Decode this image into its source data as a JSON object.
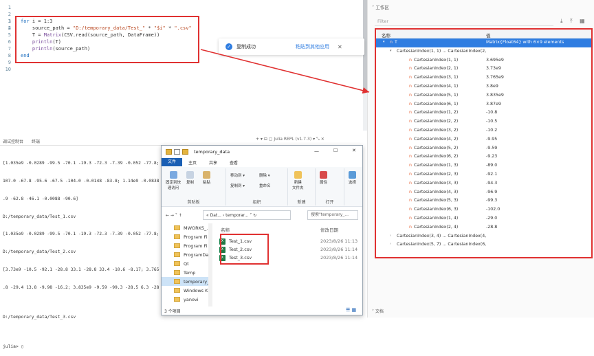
{
  "editor": {
    "line_numbers": [
      "1",
      "2",
      "3",
      "4",
      "5",
      "6",
      "7",
      "8",
      "9",
      "10"
    ],
    "code": {
      "l3_kw": "for",
      "l3_rest": " i = 1:3",
      "l4_a": "    source_path = ",
      "l4_b": "\"D:/temporary_data/Test_\"",
      "l4_c": " * ",
      "l4_d": "\"$i\"",
      "l4_e": " * ",
      "l4_f": "\".csv\"",
      "l5_a": "    T = ",
      "l5_b": "Matrix",
      "l5_c": "(CSV.read(source_path, DataFrame))",
      "l6_a": "    ",
      "l6_b": "println",
      "l6_c": "(T)",
      "l7_a": "    ",
      "l7_b": "println",
      "l7_c": "(source_path)",
      "l8": "end"
    }
  },
  "toast": {
    "message": "复制成功",
    "link": "粘贴到其他应用",
    "close": "✕",
    "check": "✓"
  },
  "repl": {
    "tab_debug": "调试控制台",
    "tab_terminal": "终端",
    "toolbar": "+ ▾ ⊟ ▢ Julia REPL (v1.7.3) ▾ ⤡ ✕",
    "lines": [
      "[1.035e9 -0.0289 -99.5 -70.1 -19.3 -72.3 -7.39 -0.052 -77.8;",
      "107.0 -67.8 -95.6 -67.5 -104.0 -0.0148 -83.8; 1.14e9 -0.0838",
      ".9 -62.8 -46.1 -0.0088 -90.6]",
      "D:/temporary_data/Test_1.csv",
      "[1.035e9 -0.0289 -99.5 -70.1 -19.3 -72.3 -7.39 -0.052 -77.8;",
      "D:/temporary_data/Test_2.csv",
      "[3.73e9 -10.5 -92.1 -28.8 33.1 -28.8 33.4 -10.6 -8.17; 3.765e",
      ".8 -29.4 13.8 -9.98 -16.2; 3.835e9 -9.59 -99.3 -28.5 6.3 -28.",
      "",
      "D:/temporary_data/Test_3.csv",
      "",
      "julia> ▯"
    ]
  },
  "explorer": {
    "title": "temporary_data",
    "win_min": "—",
    "win_max": "☐",
    "win_close": "✕",
    "ribbon_tabs": [
      "文件",
      "主页",
      "共享",
      "查看"
    ],
    "ribbon": {
      "pin": "固定到快\n速访问",
      "copy": "复制",
      "paste": "粘贴",
      "move_to": "移动到 ▾",
      "delete": "删除 ▾",
      "copy_to": "复制到 ▾",
      "rename": "重命名",
      "new_folder": "新建\n文件夹",
      "properties": "属性",
      "select": "选择",
      "g_clipboard": "剪贴板",
      "g_organize": "组织",
      "g_new": "新建",
      "g_open": "打开"
    },
    "addr_nav": "←  →  ˅  ↑",
    "addr_path": "«  Dat...  ›  temporar...  ˅  ↻",
    "search_placeholder": "搜索\"temporary_...",
    "nav_items": [
      "MWORKS_...",
      "Program Fi",
      "Program Fi",
      "ProgramDa",
      "Qt",
      "Temp",
      "temporary_",
      "Windows K",
      "yanovi"
    ],
    "col_name": "名称",
    "col_date": "修改日期",
    "files": [
      {
        "name": "Test_1.csv",
        "date": "2023/8/26 11:13"
      },
      {
        "name": "Test_2.csv",
        "date": "2023/8/26 11:14"
      },
      {
        "name": "Test_3.csv",
        "date": "2023/8/26 11:14"
      }
    ],
    "status": "3 个项目",
    "view_icons": "☰ ▦"
  },
  "workspace": {
    "title": "˅ 工作区",
    "filter_placeholder": "Filter",
    "tools": "⤓ ⤒ ▦",
    "col_name": "名称",
    "col_value": "值",
    "var_row": {
      "name": "T",
      "value": "Matrix{Float64} with 6×9 elements"
    },
    "group1": "CartesianIndex(1, 1) ... CartesianIndex(2,",
    "entries": [
      {
        "name": "CartesianIndex(1, 1)",
        "value": "3.695e9"
      },
      {
        "name": "CartesianIndex(2, 1)",
        "value": "3.73e9"
      },
      {
        "name": "CartesianIndex(3, 1)",
        "value": "3.765e9"
      },
      {
        "name": "CartesianIndex(4, 1)",
        "value": "3.8e9"
      },
      {
        "name": "CartesianIndex(5, 1)",
        "value": "3.835e9"
      },
      {
        "name": "CartesianIndex(6, 1)",
        "value": "3.87e9"
      },
      {
        "name": "CartesianIndex(1, 2)",
        "value": "-10.8"
      },
      {
        "name": "CartesianIndex(2, 2)",
        "value": "-10.5"
      },
      {
        "name": "CartesianIndex(3, 2)",
        "value": "-10.2"
      },
      {
        "name": "CartesianIndex(4, 2)",
        "value": "-9.95"
      },
      {
        "name": "CartesianIndex(5, 2)",
        "value": "-9.59"
      },
      {
        "name": "CartesianIndex(6, 2)",
        "value": "-9.23"
      },
      {
        "name": "CartesianIndex(1, 3)",
        "value": "-89.0"
      },
      {
        "name": "CartesianIndex(2, 3)",
        "value": "-92.1"
      },
      {
        "name": "CartesianIndex(3, 3)",
        "value": "-94.3"
      },
      {
        "name": "CartesianIndex(4, 3)",
        "value": "-96.9"
      },
      {
        "name": "CartesianIndex(5, 3)",
        "value": "-99.3"
      },
      {
        "name": "CartesianIndex(6, 3)",
        "value": "-102.0"
      },
      {
        "name": "CartesianIndex(1, 4)",
        "value": "-29.0"
      },
      {
        "name": "CartesianIndex(2, 4)",
        "value": "-28.8"
      }
    ],
    "group2": "CartesianIndex(3, 4) ... CartesianIndex(4,",
    "group3": "CartesianIndex(5, 7) ... CartesianIndex(6,",
    "doc_label": "˃ 文档",
    "tag": "n",
    "var_tag": "n"
  },
  "colors": {
    "highlight_red": "#e03131",
    "accent_blue": "#2f7de1",
    "ribbon_blue": "#1a5fb4"
  }
}
